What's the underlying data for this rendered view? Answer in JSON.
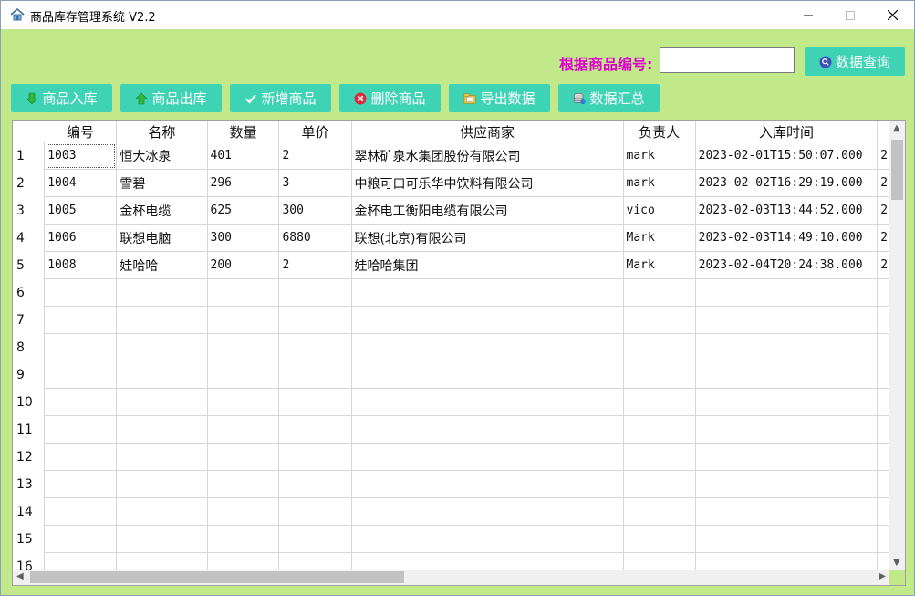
{
  "window": {
    "title": "商品库存管理系统 V2.2"
  },
  "search": {
    "label": "根据商品编号:",
    "value": "",
    "button_label": "数据查询"
  },
  "toolbar": {
    "stock_in": "商品入库",
    "stock_out": "商品出库",
    "add": "新增商品",
    "delete": "删除商品",
    "export": "导出数据",
    "summary": "数据汇总"
  },
  "table": {
    "columns": [
      "编号",
      "名称",
      "数量",
      "单价",
      "供应商家",
      "负责人",
      "入库时间"
    ],
    "rows": [
      [
        "1003",
        "恒大冰泉",
        "401",
        "2",
        "翠林矿泉水集团股份有限公司",
        "mark",
        "2023-02-01T15:50:07.000",
        "2"
      ],
      [
        "1004",
        "雪碧",
        "296",
        "3",
        "中粮可口可乐华中饮料有限公司",
        "mark",
        "2023-02-02T16:29:19.000",
        "2"
      ],
      [
        "1005",
        "金杯电缆",
        "625",
        "300",
        "金杯电工衡阳电缆有限公司",
        "vico",
        "2023-02-03T13:44:52.000",
        "2"
      ],
      [
        "1006",
        "联想电脑",
        "300",
        "6880",
        "联想(北京)有限公司",
        "Mark",
        "2023-02-03T14:49:10.000",
        "2"
      ],
      [
        "1008",
        "娃哈哈",
        "200",
        "2",
        "娃哈哈集团",
        "Mark",
        "2023-02-04T20:24:38.000",
        "2"
      ]
    ],
    "row_numbers": [
      "1",
      "2",
      "3",
      "4",
      "5",
      "6",
      "7",
      "8",
      "9",
      "10",
      "11",
      "12",
      "13",
      "14",
      "15",
      "16"
    ]
  },
  "icons": {
    "app": "home-icon",
    "stock_in": "arrow-down-icon",
    "stock_out": "arrow-up-icon",
    "add": "check-icon",
    "delete": "delete-icon",
    "export": "export-icon",
    "summary": "database-icon",
    "query": "search-icon"
  },
  "colors": {
    "background": "#c1e98a",
    "button": "#3fd3b5",
    "label": "#e000d0"
  }
}
